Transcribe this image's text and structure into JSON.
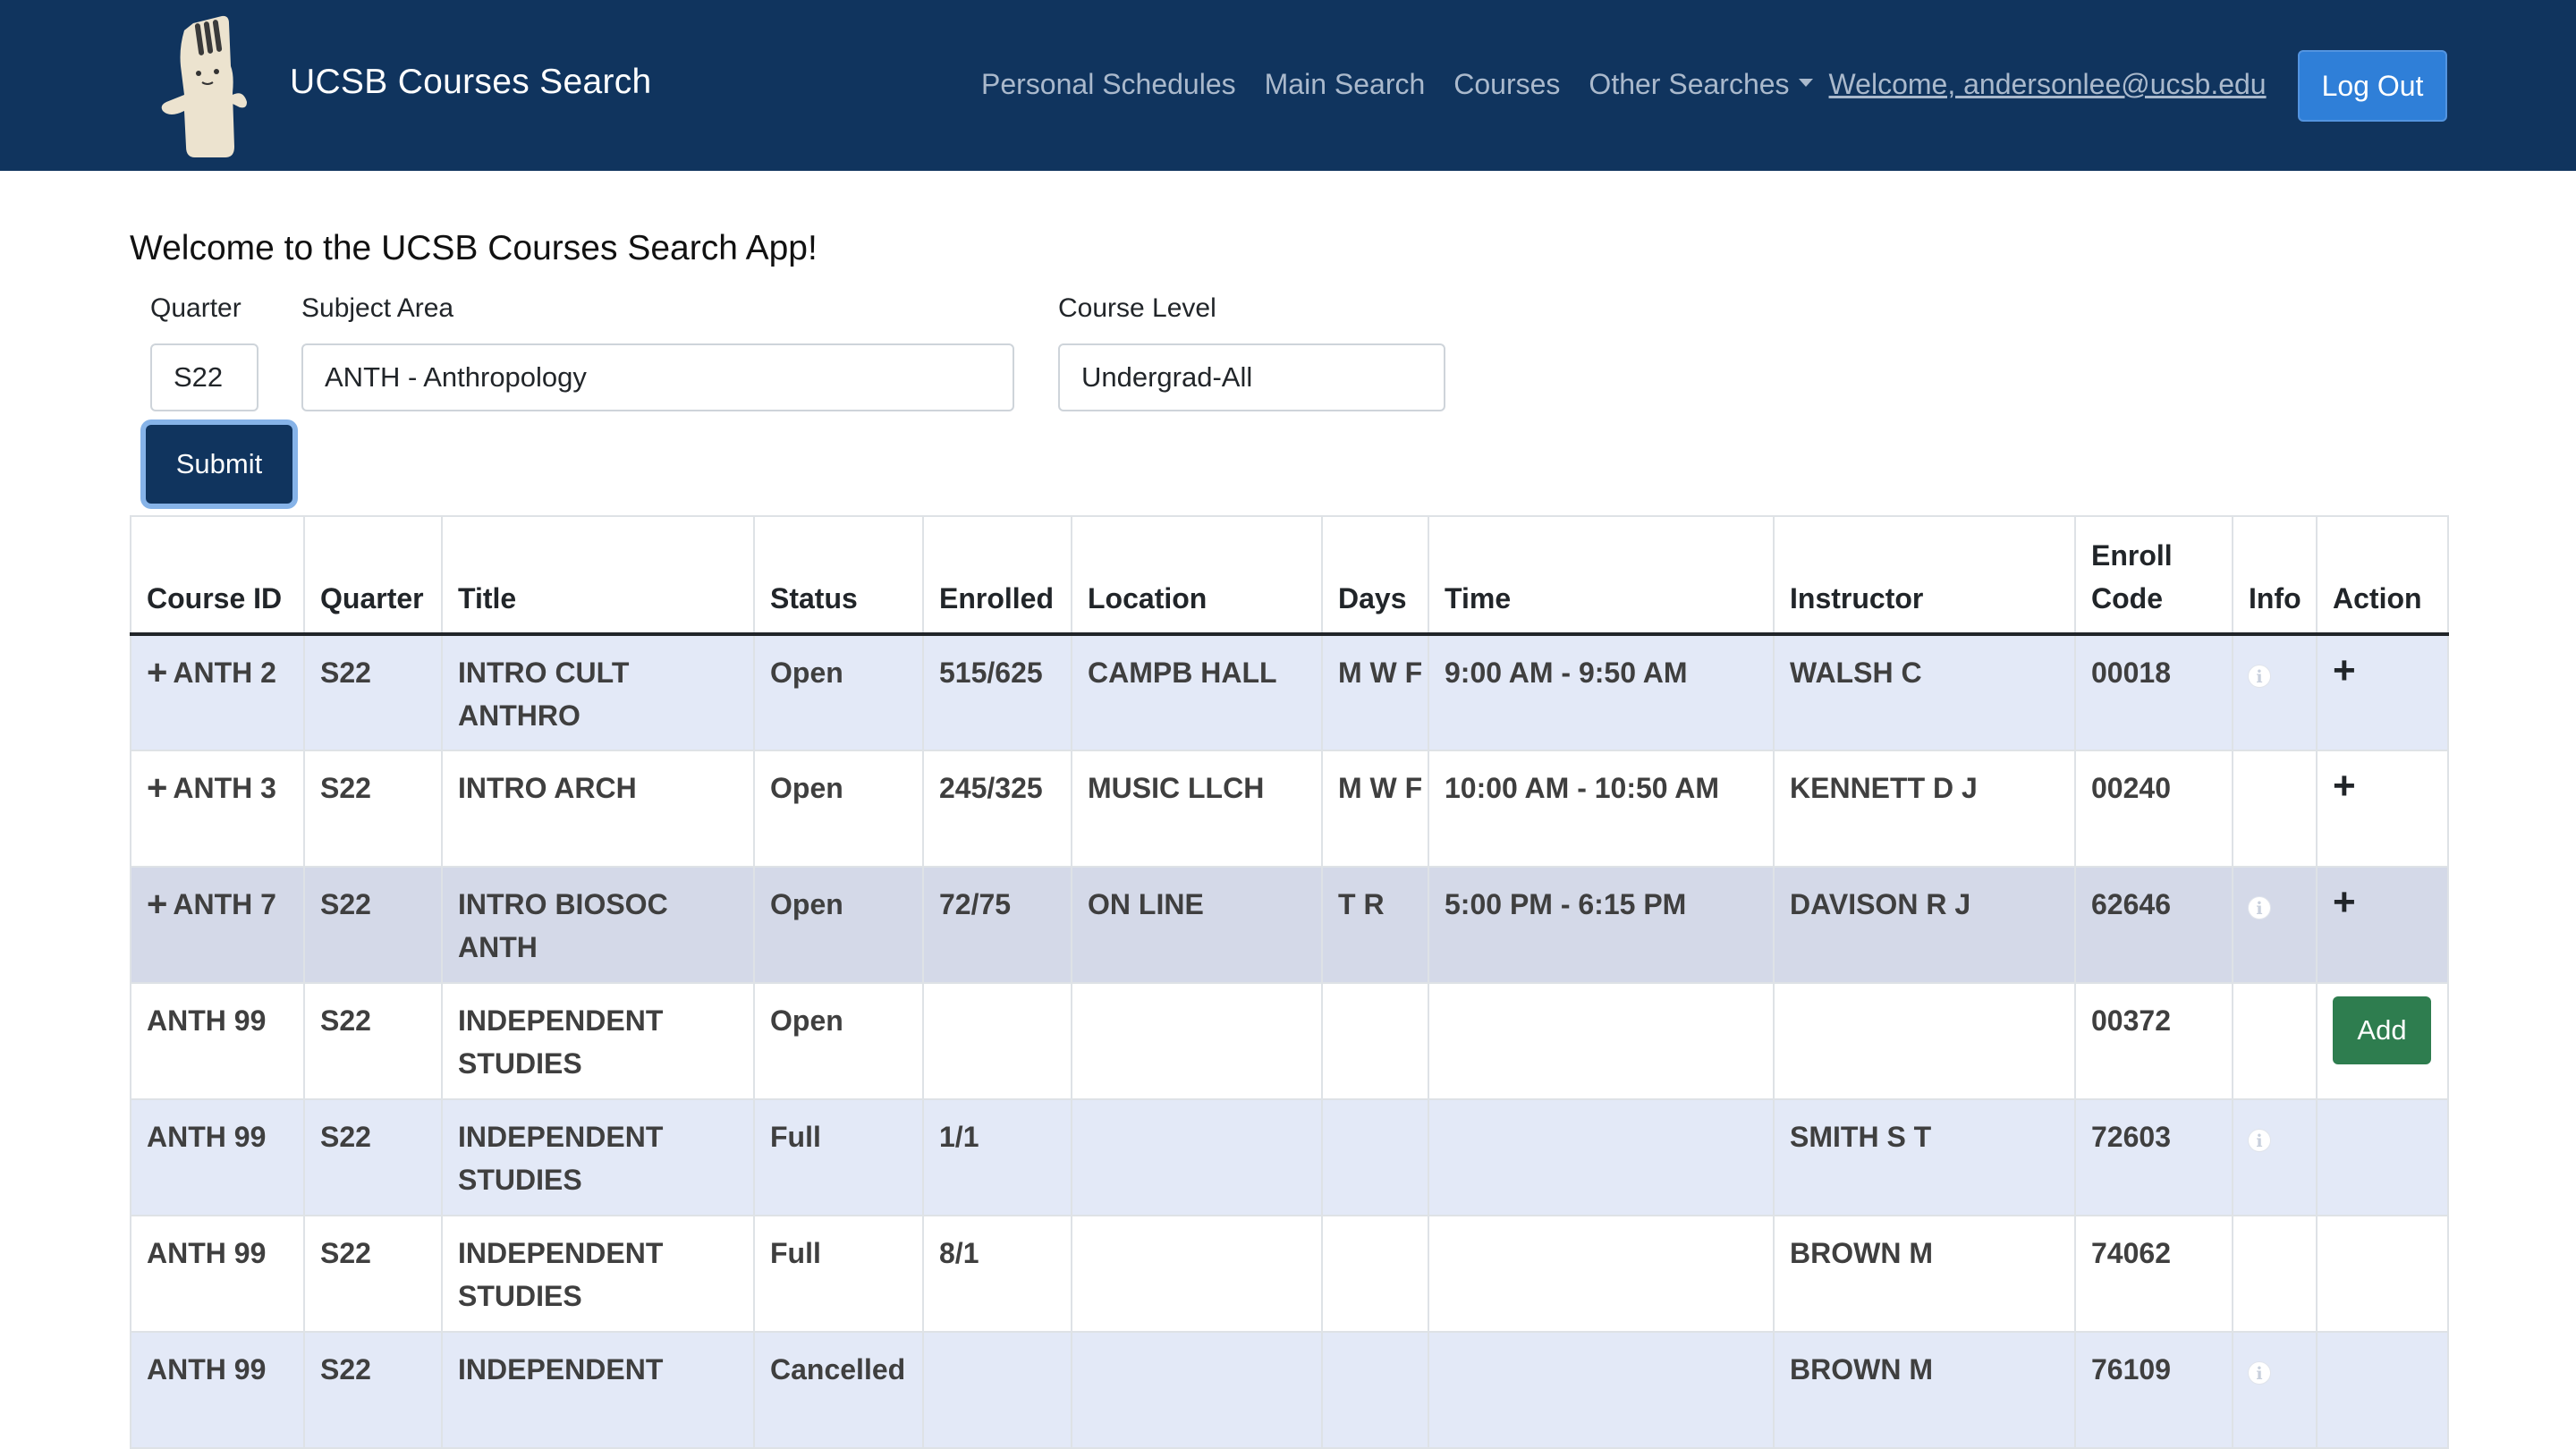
{
  "navbar": {
    "brand": "UCSB Courses Search",
    "links": [
      "Personal Schedules",
      "Main Search",
      "Courses"
    ],
    "other_searches": "Other Searches",
    "user": "Welcome, andersonlee@ucsb.edu",
    "logout": "Log Out",
    "colors": {
      "bg": "#10345e",
      "logout_btn": "#2f7fd8"
    }
  },
  "form": {
    "welcome": "Welcome to the UCSB Courses Search App!",
    "quarter_label": "Quarter",
    "quarter_value": "S22",
    "subject_label": "Subject Area",
    "subject_value": "ANTH - Anthropology",
    "level_label": "Course Level",
    "level_value": "Undergrad-All",
    "submit": "Submit"
  },
  "table": {
    "headers": [
      "Course ID",
      "Quarter",
      "Title",
      "Status",
      "Enrolled",
      "Location",
      "Days",
      "Time",
      "Instructor",
      "Enroll Code",
      "Info",
      "Action"
    ],
    "rows": [
      {
        "expand": "+",
        "course_id": "ANTH 2",
        "quarter": "S22",
        "title": "INTRO CULT ANTHRO",
        "status": "Open",
        "enrolled": "515/625",
        "location": "CAMPB HALL",
        "days": "M W F",
        "time": "9:00 AM - 9:50 AM",
        "instructor": "WALSH C",
        "code": "00018",
        "info": "info-icon",
        "action": "+"
      },
      {
        "expand": "+",
        "course_id": "ANTH 3",
        "quarter": "S22",
        "title": "INTRO ARCH",
        "status": "Open",
        "enrolled": "245/325",
        "location": "MUSIC LLCH",
        "days": "M W F",
        "time": "10:00 AM - 10:50 AM",
        "instructor": "KENNETT D J",
        "code": "00240",
        "info": "",
        "action": "+"
      },
      {
        "expand": "+",
        "course_id": "ANTH 7",
        "quarter": "S22",
        "title": "INTRO BIOSOC ANTH",
        "status": "Open",
        "enrolled": "72/75",
        "location": "ON LINE",
        "days": "T R",
        "time": "5:00 PM - 6:15 PM",
        "instructor": "DAVISON R J",
        "code": "62646",
        "info": "info-icon",
        "action": "+"
      },
      {
        "expand": "",
        "course_id": "ANTH 99",
        "quarter": "S22",
        "title": "INDEPENDENT STUDIES",
        "status": "Open",
        "enrolled": "",
        "location": "",
        "days": "",
        "time": "",
        "instructor": "",
        "code": "00372",
        "info": "",
        "action": "Add"
      },
      {
        "expand": "",
        "course_id": "ANTH 99",
        "quarter": "S22",
        "title": "INDEPENDENT STUDIES",
        "status": "Full",
        "enrolled": "1/1",
        "location": "",
        "days": "",
        "time": "",
        "instructor": "SMITH S T",
        "code": "72603",
        "info": "info-icon",
        "action": ""
      },
      {
        "expand": "",
        "course_id": "ANTH 99",
        "quarter": "S22",
        "title": "INDEPENDENT STUDIES",
        "status": "Full",
        "enrolled": "8/1",
        "location": "",
        "days": "",
        "time": "",
        "instructor": "BROWN M",
        "code": "74062",
        "info": "",
        "action": ""
      },
      {
        "expand": "",
        "course_id": "ANTH 99",
        "quarter": "S22",
        "title": "INDEPENDENT",
        "status": "Cancelled",
        "enrolled": "",
        "location": "",
        "days": "",
        "time": "",
        "instructor": "BROWN M",
        "code": "76109",
        "info": "info-icon",
        "action": ""
      }
    ]
  }
}
